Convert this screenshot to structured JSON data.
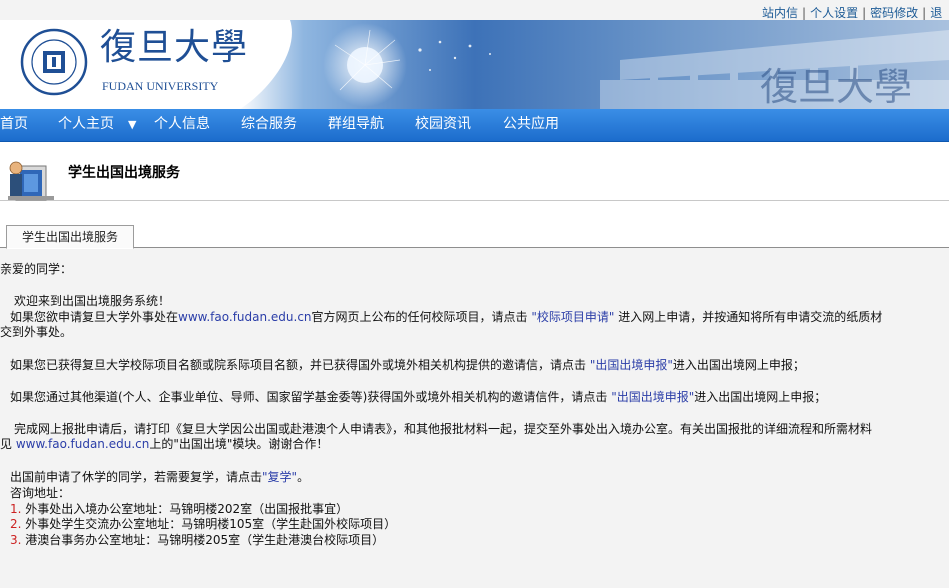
{
  "top_links": [
    "站内信",
    "个人设置",
    "密码修改",
    "退"
  ],
  "header": {
    "logo_cn": "復旦大學",
    "logo_en": "FUDAN UNIVERSITY",
    "seal_text": "FUDAN UNIVERSITY 1905"
  },
  "nav": {
    "items": [
      "首页",
      "个人主页",
      "个人信息",
      "综合服务",
      "群组导航",
      "校园资讯",
      "公共应用"
    ],
    "dropdown_arrow": "▼"
  },
  "page": {
    "title": "学生出国出境服务",
    "tab_label": "学生出国出境服务"
  },
  "content": {
    "greeting": "亲爱的同学：",
    "welcome": "欢迎来到出国出境服务系统！",
    "p1_a": "如果您欲申请复旦大学外事处在",
    "p1_link": "www.fao.fudan.edu.cn",
    "p1_b": "官方网页上公布的任何校际项目，请点击 ",
    "p1_quote_link": "\"校际项目申请\"",
    "p1_c": " 进入网上申请，并按通知将所有申请交流的纸质材",
    "p1_d": "交到外事处。",
    "p2_a": "如果您已获得复旦大学校际项目名额或院系际项目名额，并已获得国外或境外相关机构提供的邀请信，请点击 ",
    "p2_link": "\"出国出境申报\"",
    "p2_b": "进入出国出境网上申报；",
    "p3_a": "如果您通过其他渠道(个人、企事业单位、导师、国家留学基金委等)获得国外或境外相关机构的邀请信件，请点击 ",
    "p3_link": "\"出国出境申报\"",
    "p3_b": "进入出国出境网上申报；",
    "p4_a": "完成网上报批申请后，请打印《复旦大学因公出国或赴港澳个人申请表》，和其他报批材料一起，提交至外事处出入境办公室。有关出国报批的详细流程和所需材料",
    "p4_b": "见 ",
    "p4_link": "www.fao.fudan.edu.cn",
    "p4_c": "上的\"出国出境\"模块。谢谢合作！",
    "p5_a": "出国前申请了休学的同学，若需要复学，请点击",
    "p5_link": "\"复学\"",
    "p5_b": "。",
    "consult": "咨询地址：",
    "addresses": [
      {
        "num": "1.",
        "text": " 外事处出入境办公室地址：马锦明楼202室（出国报批事宜）"
      },
      {
        "num": "2.",
        "text": " 外事处学生交流办公室地址：马锦明楼105室（学生赴国外校际项目）"
      },
      {
        "num": "3.",
        "text": " 港澳台事务办公室地址：马锦明楼205室（学生赴港澳台校际项目）"
      }
    ]
  },
  "colors": {
    "nav_bg": "#2a7ed8",
    "link": "#2b3ea8",
    "top_link": "#1d5b96",
    "content_bg": "#f3f3f3"
  }
}
